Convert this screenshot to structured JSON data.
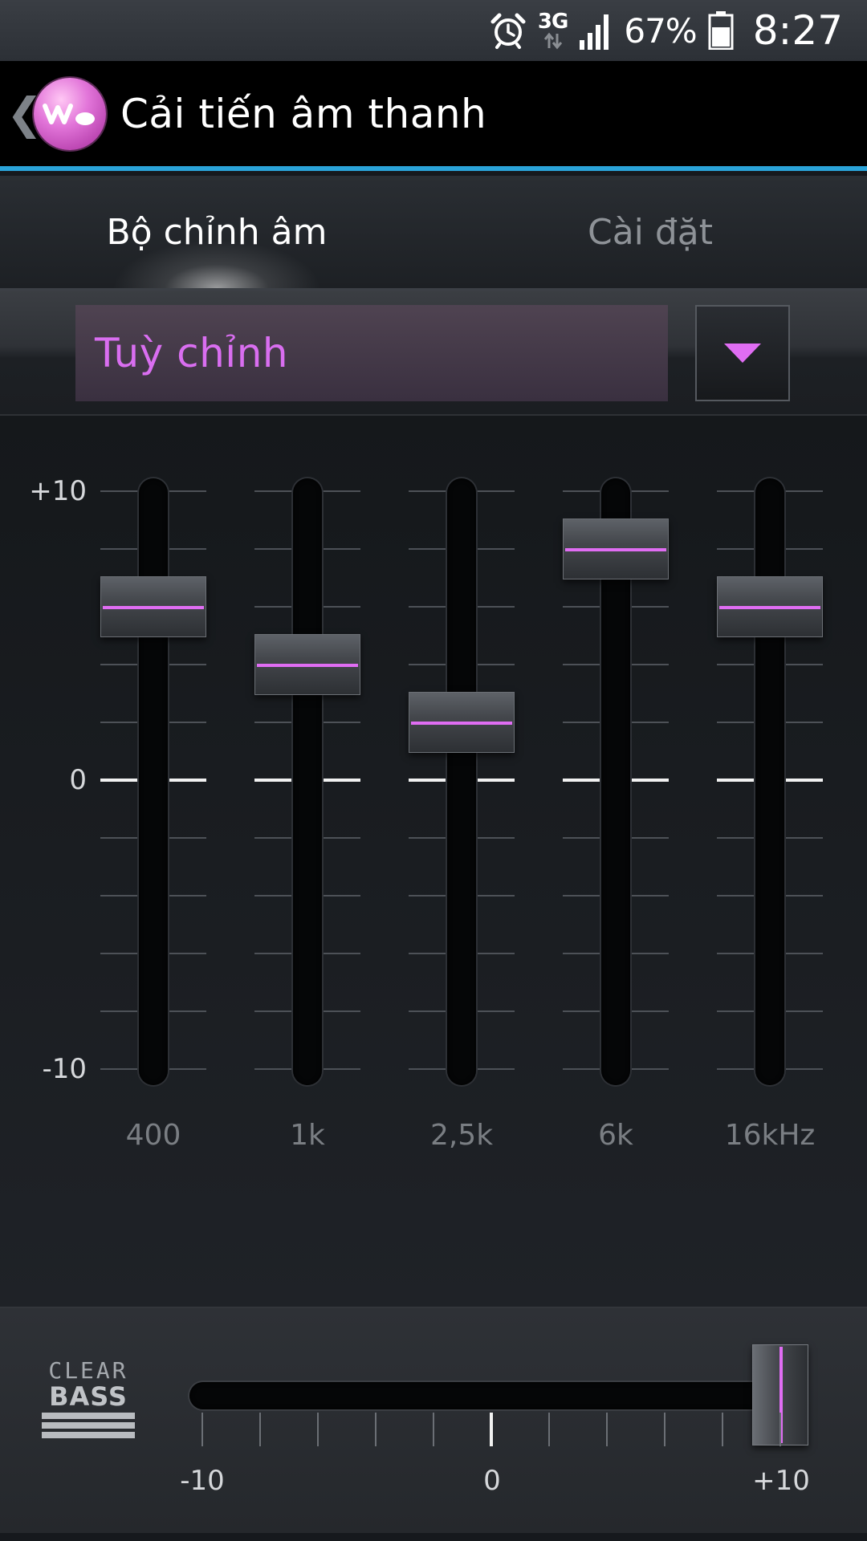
{
  "status_bar": {
    "alarm_icon": "alarm-clock-icon",
    "network": "3G",
    "signal_icon": "signal-bars-icon",
    "battery_percent": "67%",
    "battery_icon": "battery-icon",
    "time": "8:27"
  },
  "action_bar": {
    "back_glyph": "❮",
    "logo_icon": "walkman-logo-icon",
    "title": "Cải tiến âm thanh"
  },
  "tabs": [
    {
      "label": "Bộ chỉnh âm",
      "active": true
    },
    {
      "label": "Cài đặt",
      "active": false
    }
  ],
  "preset": {
    "value": "Tuỳ chỉnh",
    "dropdown_icon": "triangle-down-icon"
  },
  "equalizer": {
    "scale_max_label": "+10",
    "scale_zero_label": "0",
    "scale_min_label": "-10",
    "min": -10,
    "max": 10,
    "bands": [
      {
        "label": "400",
        "value": 6
      },
      {
        "label": "1k",
        "value": 4
      },
      {
        "label": "2,5k",
        "value": 2
      },
      {
        "label": "6k",
        "value": 8
      },
      {
        "label": "16kHz",
        "value": 6
      }
    ]
  },
  "clear_bass": {
    "logo_top": "CLEAR",
    "logo_bottom": "BASS",
    "min_label": "-10",
    "zero_label": "0",
    "max_label": "+10",
    "min": -10,
    "max": 10,
    "value": 10
  },
  "colors": {
    "accent_blue": "#2aa3d8",
    "accent_magenta": "#e06df3",
    "preset_text": "#d96ef0"
  }
}
